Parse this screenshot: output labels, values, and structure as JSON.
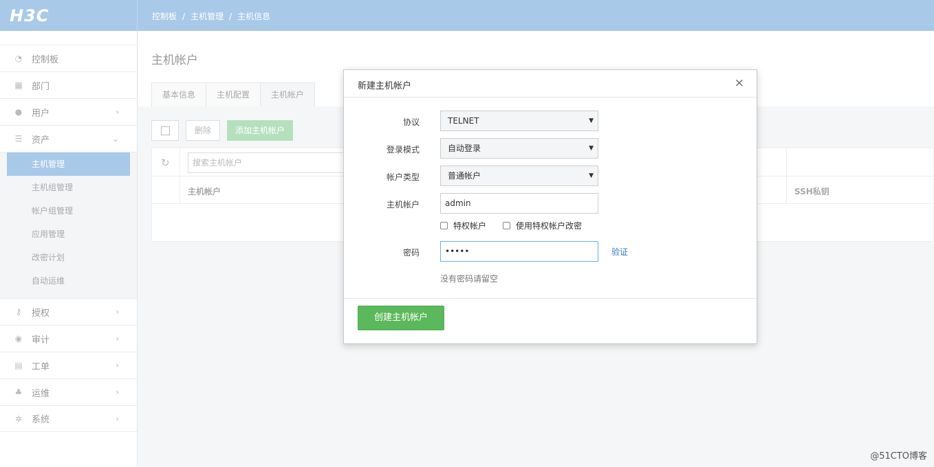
{
  "header": {
    "logo": "H3C",
    "breadcrumb": [
      "控制板",
      "主机管理",
      "主机信息"
    ]
  },
  "sidebar": {
    "items": [
      {
        "label": "控制板",
        "icon": "dashboard-icon",
        "chevron": false
      },
      {
        "label": "部门",
        "icon": "grid-icon",
        "chevron": false
      },
      {
        "label": "用户",
        "icon": "user-icon",
        "chevron": true
      },
      {
        "label": "资产",
        "icon": "server-icon",
        "chevron": true,
        "expanded": true
      }
    ],
    "submenu": [
      {
        "label": "主机管理",
        "active": true
      },
      {
        "label": "主机组管理"
      },
      {
        "label": "帐户组管理"
      },
      {
        "label": "应用管理"
      },
      {
        "label": "改密计划"
      },
      {
        "label": "自动运维"
      }
    ],
    "items_after": [
      {
        "label": "授权",
        "icon": "key-icon"
      },
      {
        "label": "审计",
        "icon": "eye-icon"
      },
      {
        "label": "工单",
        "icon": "file-icon"
      },
      {
        "label": "运维",
        "icon": "sitemap-icon"
      },
      {
        "label": "系统",
        "icon": "gear-icon"
      }
    ]
  },
  "main": {
    "title": "主机帐户",
    "tabs": [
      "基本信息",
      "主机配置",
      "主机帐户"
    ],
    "toolbar": {
      "delete_label": "删除",
      "add_label": "添加主机帐户"
    },
    "search_placeholder": "搜索主机帐户",
    "columns": [
      "主机帐户",
      "SSH私钥"
    ]
  },
  "modal": {
    "title": "新建主机帐户",
    "close": "×",
    "fields": {
      "protocol_label": "协议",
      "protocol_value": "TELNET",
      "login_mode_label": "登录模式",
      "login_mode_value": "自动登录",
      "account_type_label": "帐户类型",
      "account_type_value": "普通帐户",
      "host_account_label": "主机帐户",
      "host_account_value": "admin",
      "privileged_label": "特权帐户",
      "use_privileged_label": "使用特权帐户改密",
      "password_label": "密码",
      "password_value": "•••••",
      "verify_label": "验证",
      "hint": "没有密码请留空"
    },
    "submit_label": "创建主机帐户"
  },
  "watermark": "@51CTO博客",
  "colors": {
    "topbar": "#a9c9e8",
    "primary_button": "#5cb85c",
    "link": "#337ab7"
  }
}
